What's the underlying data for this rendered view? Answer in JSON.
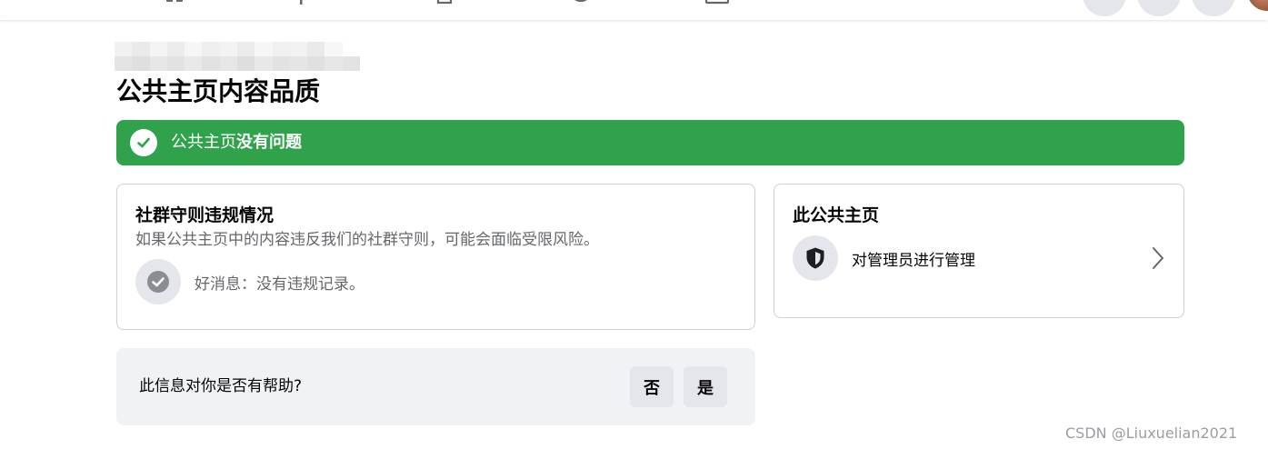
{
  "nav": {
    "icons": [
      "home-icon",
      "video-icon",
      "marketplace-icon",
      "groups-icon",
      "gaming-icon"
    ],
    "right_buttons": [
      "menu-button",
      "messenger-button",
      "notifications-button"
    ]
  },
  "page": {
    "title": "公共主页内容品质"
  },
  "status": {
    "prefix": "公共主页",
    "emphasis": "没有问题",
    "color": "#31a24c"
  },
  "violations_card": {
    "title": "社群守则违规情况",
    "description": "如果公共主页中的内容违反我们的社群守则，可能会面临受限风险。",
    "good_news": "好消息：没有违规记录。"
  },
  "page_card": {
    "title": "此公共主页",
    "admin_label": "对管理员进行管理"
  },
  "feedback": {
    "question": "此信息对你是否有帮助?",
    "no_label": "否",
    "yes_label": "是"
  },
  "watermark": "CSDN @Liuxuelian2021"
}
